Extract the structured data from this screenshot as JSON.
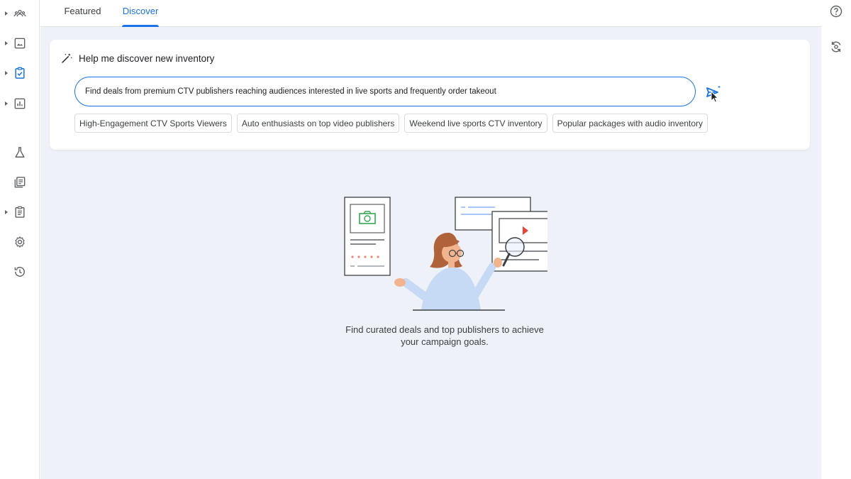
{
  "tabs": [
    {
      "label": "Featured",
      "active": false
    },
    {
      "label": "Discover",
      "active": true
    }
  ],
  "left_rail": {
    "items": [
      {
        "icon": "audience-icon",
        "expandable": true
      },
      {
        "icon": "creative-icon",
        "expandable": true
      },
      {
        "icon": "inventory-icon",
        "expandable": true,
        "active": true
      },
      {
        "icon": "reports-icon",
        "expandable": true
      },
      {
        "icon": "experiments-icon",
        "expandable": false
      },
      {
        "icon": "library-icon",
        "expandable": false
      },
      {
        "icon": "clipboard-icon",
        "expandable": true
      },
      {
        "icon": "settings-icon",
        "expandable": false
      },
      {
        "icon": "history-icon",
        "expandable": false
      }
    ]
  },
  "right_rail": {
    "items": [
      {
        "icon": "help-icon"
      },
      {
        "icon": "sync-icon"
      }
    ]
  },
  "discover": {
    "title": "Help me discover new inventory",
    "prompt_value": "Find deals from premium CTV publishers reaching audiences interested in live sports and frequently order takeout",
    "suggestions": [
      "High-Engagement CTV Sports Viewers",
      "Auto enthusiasts on top video publishers",
      "Weekend live sports CTV inventory",
      "Popular packages with audio inventory"
    ]
  },
  "empty_state": {
    "line1": "Find curated deals and top publishers to achieve",
    "line2": "your campaign goals."
  },
  "colors": {
    "accent": "#1a73e8",
    "background": "#eef2f8",
    "surface": "#ffffff"
  }
}
